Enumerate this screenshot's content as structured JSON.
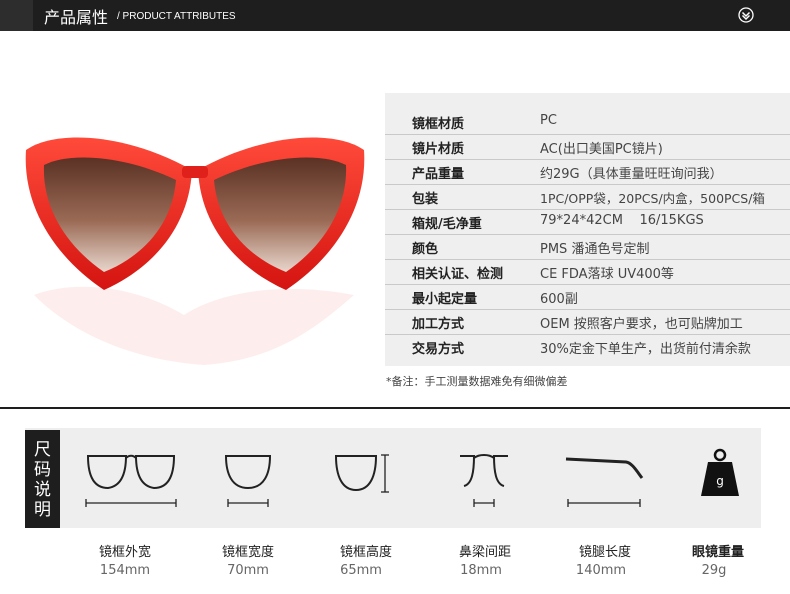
{
  "header": {
    "title": "产品属性",
    "subtitle": "/ PRODUCT ATTRIBUTES"
  },
  "attributes": [
    {
      "label": "镜框材质",
      "value": "PC"
    },
    {
      "label": "镜片材质",
      "value": "AC(出口美国PC镜片)"
    },
    {
      "label": "产品重量",
      "value": "约29G（具体重量旺旺询问我）"
    },
    {
      "label": "包装",
      "value": "1PC/OPP袋，20PCS/内盒，500PCS/箱"
    },
    {
      "label": "箱规/毛净重",
      "value": "79*24*42CM    16/15KGS"
    },
    {
      "label": "颜色",
      "value": "PMS 潘通色号定制"
    },
    {
      "label": "相关认证、检测",
      "value": "CE FDA落球 UV400等"
    },
    {
      "label": "最小起定量",
      "value": "600副"
    },
    {
      "label": "加工方式",
      "value": "OEM 按照客户要求，也可贴牌加工"
    },
    {
      "label": "交易方式",
      "value": "30%定金下单生产，出货前付清余款"
    }
  ],
  "note": "*备注：手工测量数据难免有细微偏差",
  "size_section": {
    "tab_chars": [
      "尺",
      "码",
      "说",
      "明"
    ],
    "weight_icon_letter": "g",
    "items": [
      {
        "label": "镜框外宽",
        "value": "154mm",
        "icon": "frame-width-icon"
      },
      {
        "label": "镜框宽度",
        "value": "70mm",
        "icon": "lens-width-icon"
      },
      {
        "label": "镜框高度",
        "value": "65mm",
        "icon": "lens-height-icon"
      },
      {
        "label": "鼻梁间距",
        "value": "18mm",
        "icon": "bridge-icon"
      },
      {
        "label": "镜腿长度",
        "value": "140mm",
        "icon": "temple-icon"
      },
      {
        "label": "眼镜重量",
        "value": "29g",
        "icon": "weight-icon"
      }
    ]
  },
  "colors": {
    "frame_red": "#e0201b",
    "lens_brown": "#7a4a38"
  }
}
